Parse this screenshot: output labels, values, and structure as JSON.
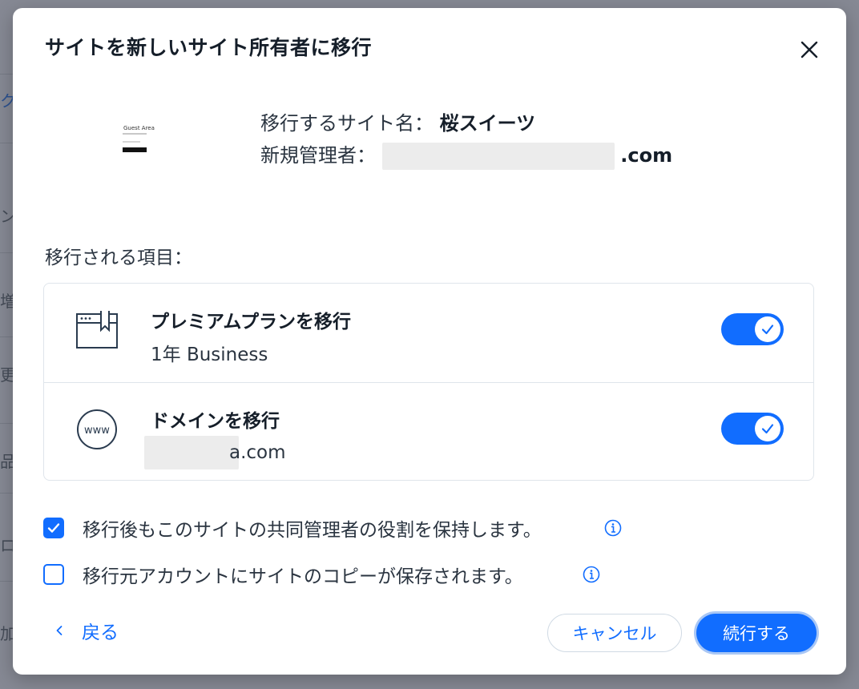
{
  "dialog": {
    "title": "サイトを新しいサイト所有者に移行",
    "site_thumbnail_title": "Guest Area",
    "site_name_label": "移行するサイト名：",
    "site_name": "桜スイーツ",
    "new_admin_label": "新規管理者：",
    "new_admin_email_suffix": ".com",
    "transfer_items_label": "移行される項目：",
    "items": [
      {
        "title": "プレミアムプランを移行",
        "subtitle": "1年 Business",
        "icon": "browser-bookmark-icon",
        "enabled": true
      },
      {
        "title": "ドメインを移行",
        "subtitle_suffix": "a.com",
        "icon": "www-globe-icon",
        "icon_text": "www",
        "enabled": true
      }
    ],
    "options": [
      {
        "label": "移行後もこのサイトの共同管理者の役割を保持します。",
        "checked": true
      },
      {
        "label": "移行元アカウントにサイトのコピーが保存されます。",
        "checked": false
      }
    ],
    "back_label": "戻る",
    "cancel_label": "キャンセル",
    "continue_label": "続行する"
  },
  "background_fragments": [
    "ク",
    "ン",
    "増",
    "更し",
    "品を",
    "ロマ",
    "加"
  ],
  "colors": {
    "accent": "#116dff",
    "title_text": "#151e29",
    "body_text": "#2a3440",
    "overlay": "rgba(40, 44, 60, 0.45)"
  }
}
